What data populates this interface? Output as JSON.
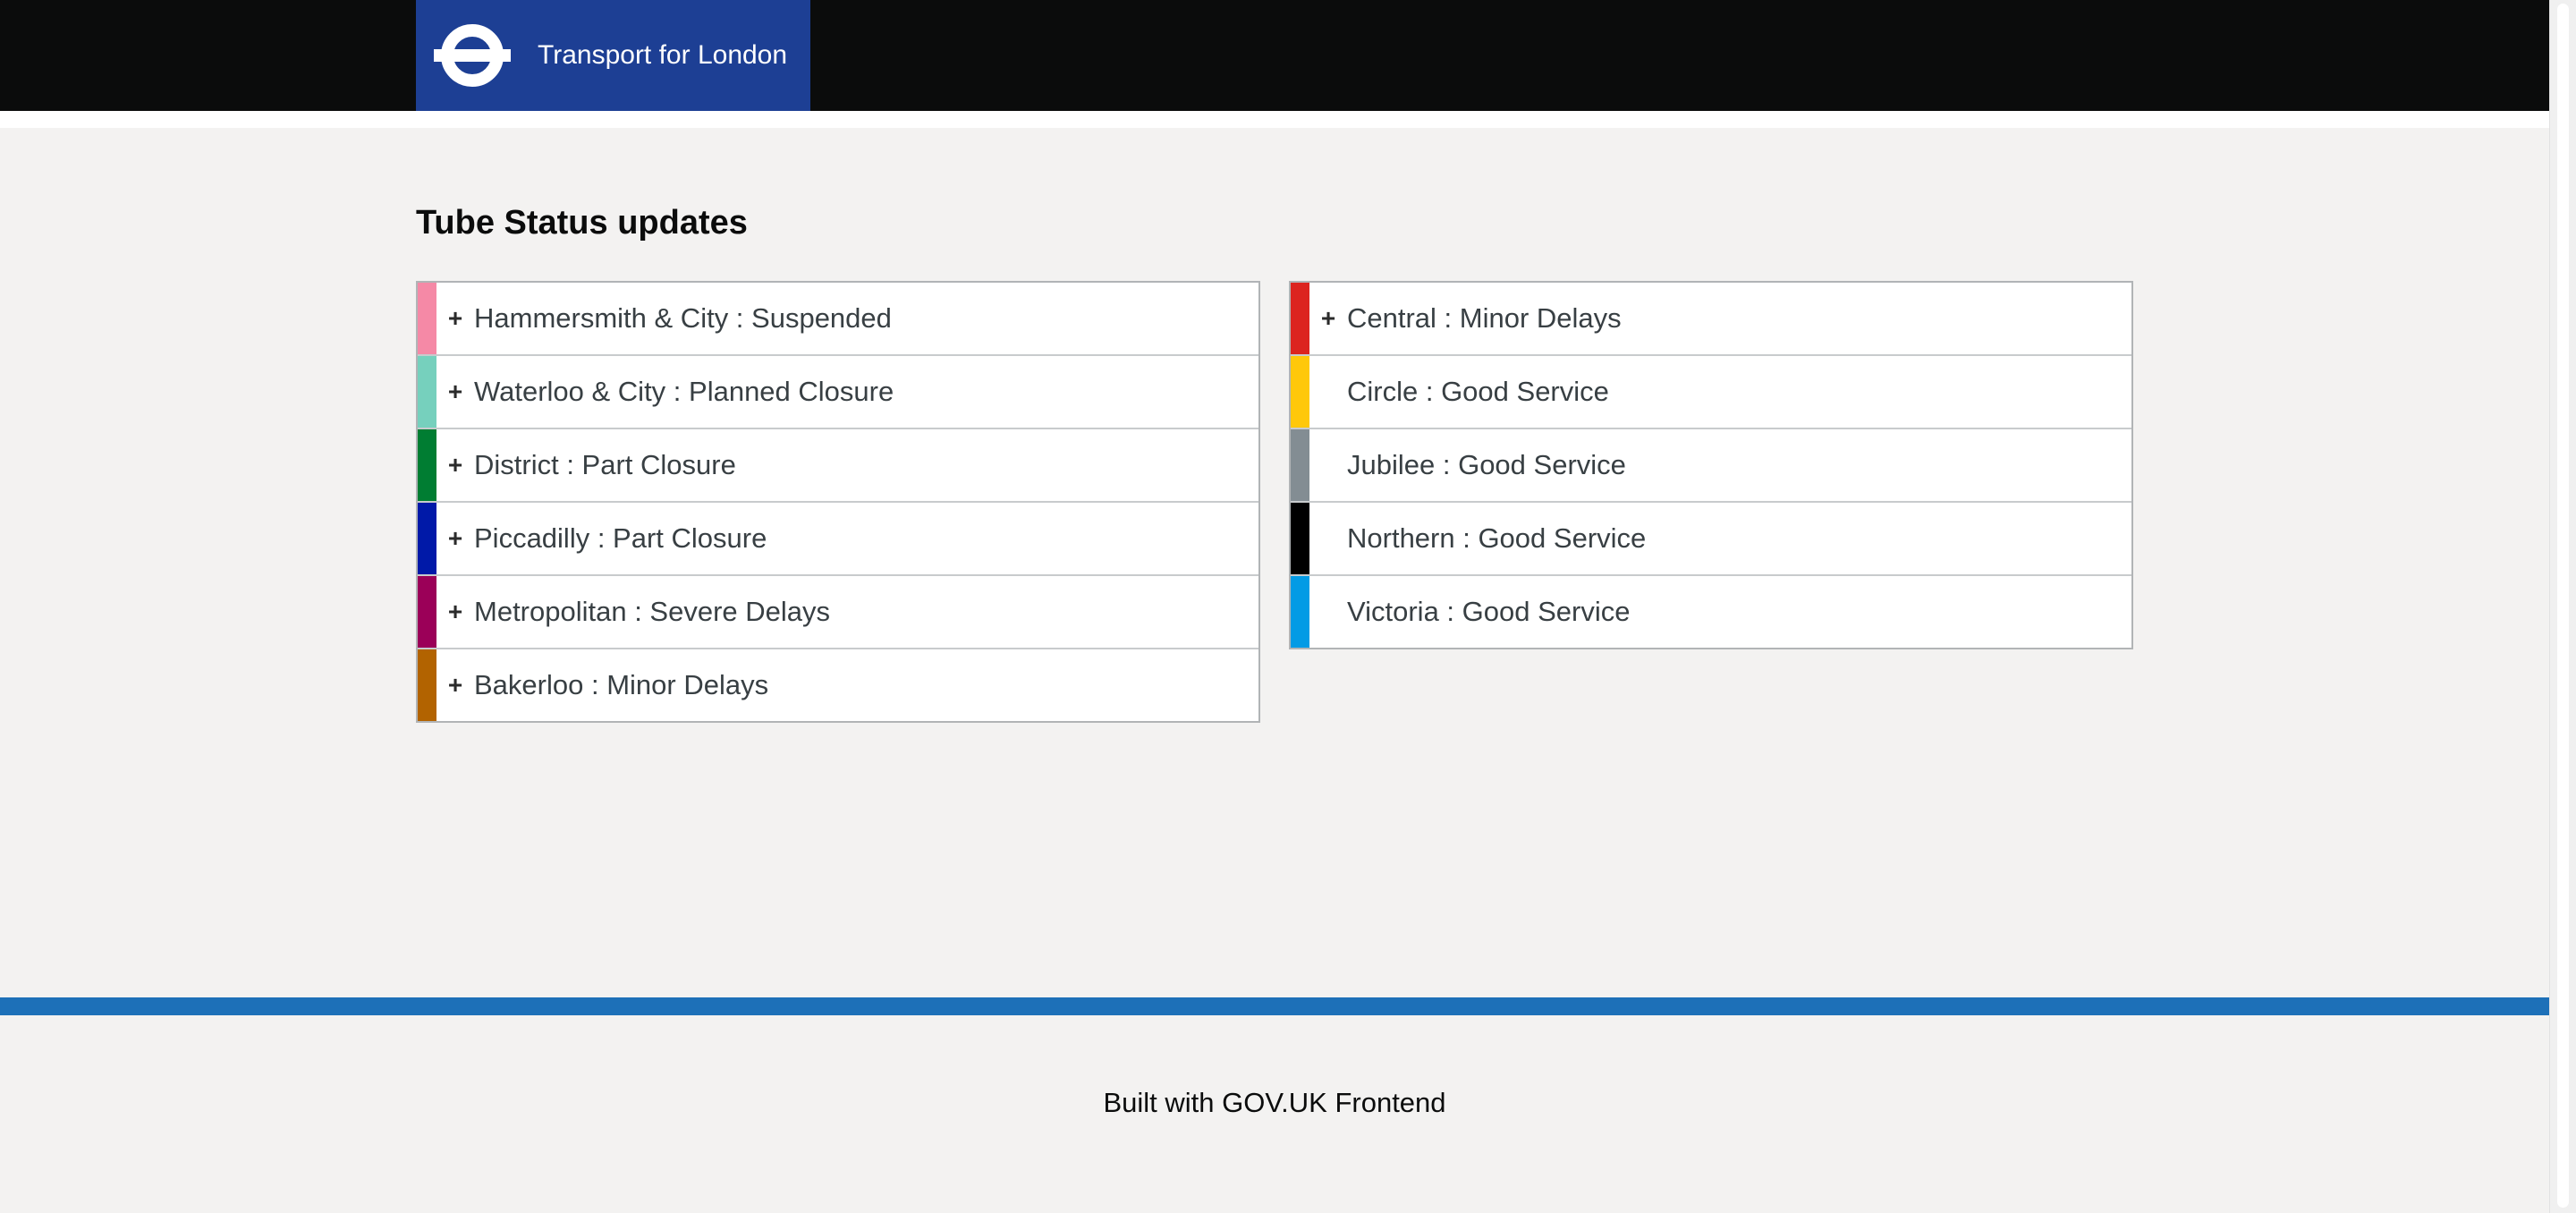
{
  "header": {
    "brand_name": "Transport for London",
    "logo_icon": "tfl-roundel-icon",
    "background_color": "#0b0c0c",
    "brand_color": "#1d3f94"
  },
  "main": {
    "title": "Tube Status updates",
    "left_lines": [
      {
        "label": "Hammersmith & City : Suspended",
        "color": "#f589a6",
        "expandable": true
      },
      {
        "label": "Waterloo & City : Planned Closure",
        "color": "#76d0bd",
        "expandable": true
      },
      {
        "label": "District : Part Closure",
        "color": "#007d32",
        "expandable": true
      },
      {
        "label": "Piccadilly : Part Closure",
        "color": "#0019a8",
        "expandable": true
      },
      {
        "label": "Metropolitan : Severe Delays",
        "color": "#9b0058",
        "expandable": true
      },
      {
        "label": "Bakerloo : Minor Delays",
        "color": "#b26300",
        "expandable": true
      }
    ],
    "right_lines": [
      {
        "label": "Central : Minor Delays",
        "color": "#dc241f",
        "expandable": true
      },
      {
        "label": "Circle : Good Service",
        "color": "#ffc80a",
        "expandable": false
      },
      {
        "label": "Jubilee : Good Service",
        "color": "#838d93",
        "expandable": false
      },
      {
        "label": "Northern : Good Service",
        "color": "#000000",
        "expandable": false
      },
      {
        "label": "Victoria : Good Service",
        "color": "#039be5",
        "expandable": false
      }
    ],
    "expand_symbol": "+",
    "expand_icon": "plus-icon"
  },
  "footer": {
    "text": "Built with GOV.UK Frontend",
    "bar_color": "#1d70b8"
  }
}
